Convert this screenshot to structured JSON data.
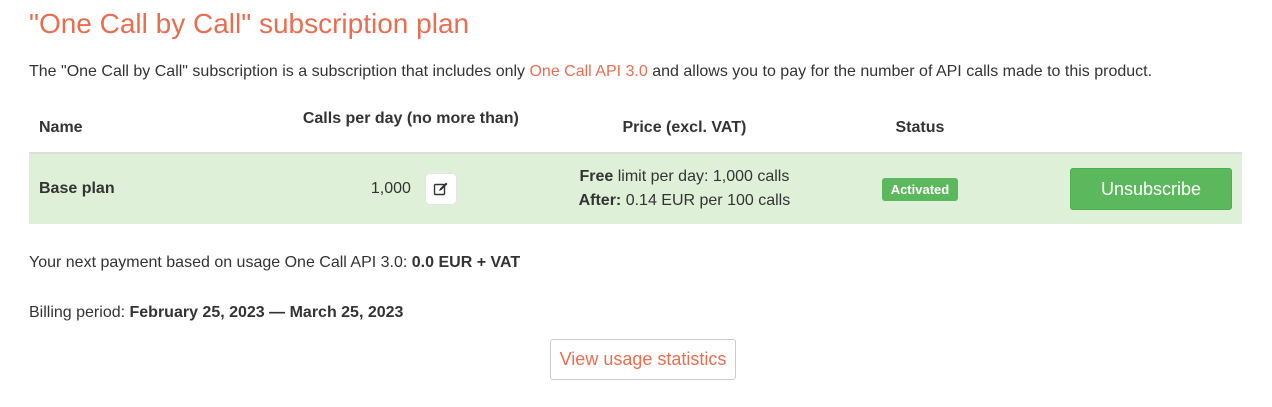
{
  "title": "\"One Call by Call\" subscription plan",
  "description": {
    "before": "The \"One Call by Call\" subscription is a subscription that includes only ",
    "link": "One Call API 3.0",
    "after": " and allows you to pay for the number of API calls made to this product."
  },
  "table": {
    "headers": {
      "name": "Name",
      "calls": "Calls per day (no more than)",
      "price": "Price (excl. VAT)",
      "status": "Status"
    },
    "row": {
      "name": "Base plan",
      "calls": "1,000",
      "price_free_label": "Free",
      "price_free_text": " limit per day: 1,000 calls",
      "price_after_label": "After:",
      "price_after_text": " 0.14 EUR per 100 calls",
      "status": "Activated",
      "action": "Unsubscribe"
    }
  },
  "next_payment": {
    "label": "Your next payment based on usage One Call API 3.0: ",
    "value": "0.0 EUR + VAT"
  },
  "billing": {
    "label": "Billing period: ",
    "value": "February 25, 2023 — March 25, 2023"
  },
  "stats_button": "View usage statistics",
  "colors": {
    "accent": "#e96e50",
    "success": "#5cb85c",
    "row_bg": "#dff0d8"
  },
  "icons": {
    "edit": "edit-icon"
  }
}
